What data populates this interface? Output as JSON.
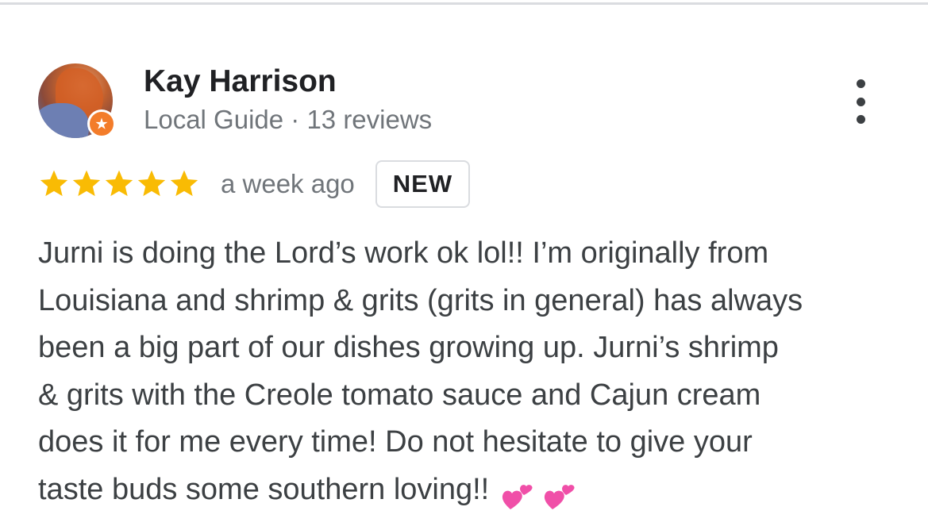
{
  "review": {
    "reviewer_name": "Kay Harrison",
    "reviewer_meta": "Local Guide · 13 reviews",
    "rating": 5,
    "rating_max": 5,
    "date": "a week ago",
    "badge": "NEW",
    "text_lines": [
      "Jurni is doing the Lord’s work ok lol!! I’m originally from",
      "Louisiana and shrimp & grits (grits in general) has always",
      "been a big part of our dishes growing up. Jurni’s shrimp",
      "& grits with the Creole tomato sauce and Cajun cream",
      "does it for me every time! Do not hesitate to give your",
      "taste buds some southern loving!!"
    ],
    "trailing_emoji": "two-hearts-icon x2"
  },
  "icons": {
    "avatar": "avatar",
    "guide_badge": "local-guide-star-icon",
    "menu": "more-vertical-icon",
    "star": "star-icon",
    "hearts": "two-hearts-icon"
  },
  "colors": {
    "star": "#F9BB04",
    "name": "#202124",
    "meta": "#70757A",
    "body_text": "#3C4043",
    "badge_border": "#DADCE0",
    "guide_badge": "#F37C2A",
    "hearts": "#F04FA8"
  }
}
